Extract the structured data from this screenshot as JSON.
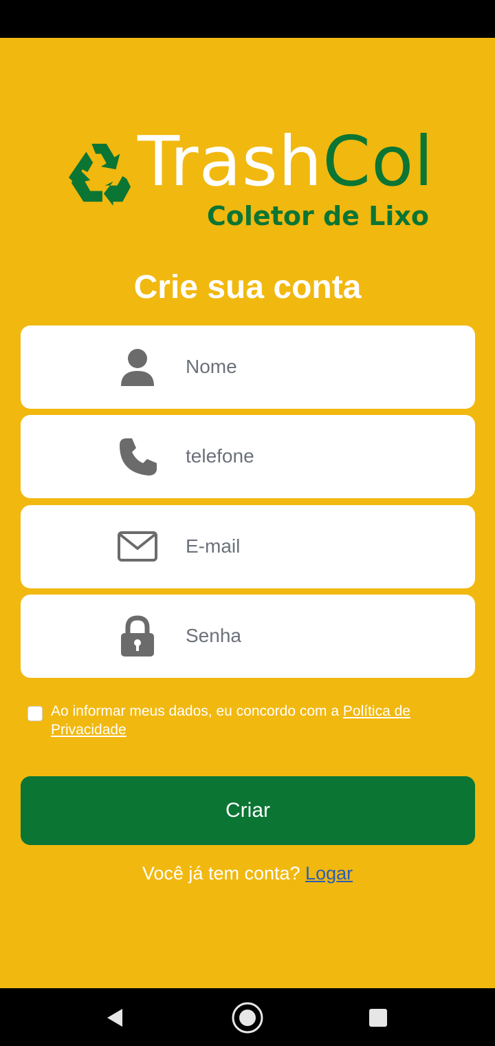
{
  "brand": {
    "name_part1": "Trash",
    "name_part2": "Col",
    "tagline": "Coletor de Lixo"
  },
  "page": {
    "title": "Crie sua conta"
  },
  "form": {
    "fields": [
      {
        "icon": "person-icon",
        "placeholder": "Nome",
        "value": ""
      },
      {
        "icon": "phone-icon",
        "placeholder": "telefone",
        "value": ""
      },
      {
        "icon": "mail-icon",
        "placeholder": "E-mail",
        "value": ""
      },
      {
        "icon": "lock-icon",
        "placeholder": "Senha",
        "value": ""
      }
    ],
    "consent_text": "Ao informar meus dados, eu concordo com a ",
    "consent_link": "Política de Privacidade",
    "consent_checked": false,
    "submit_label": "Criar"
  },
  "footer": {
    "prompt": "Você já tem conta?",
    "login_link": "Logar"
  },
  "colors": {
    "background": "#F1B80F",
    "brand_green": "#0B7534",
    "link_blue": "#2C5DB5",
    "icon_gray": "#6B6B6B"
  },
  "navigation": {
    "icons": [
      "back-icon",
      "home-icon",
      "recents-icon"
    ]
  }
}
